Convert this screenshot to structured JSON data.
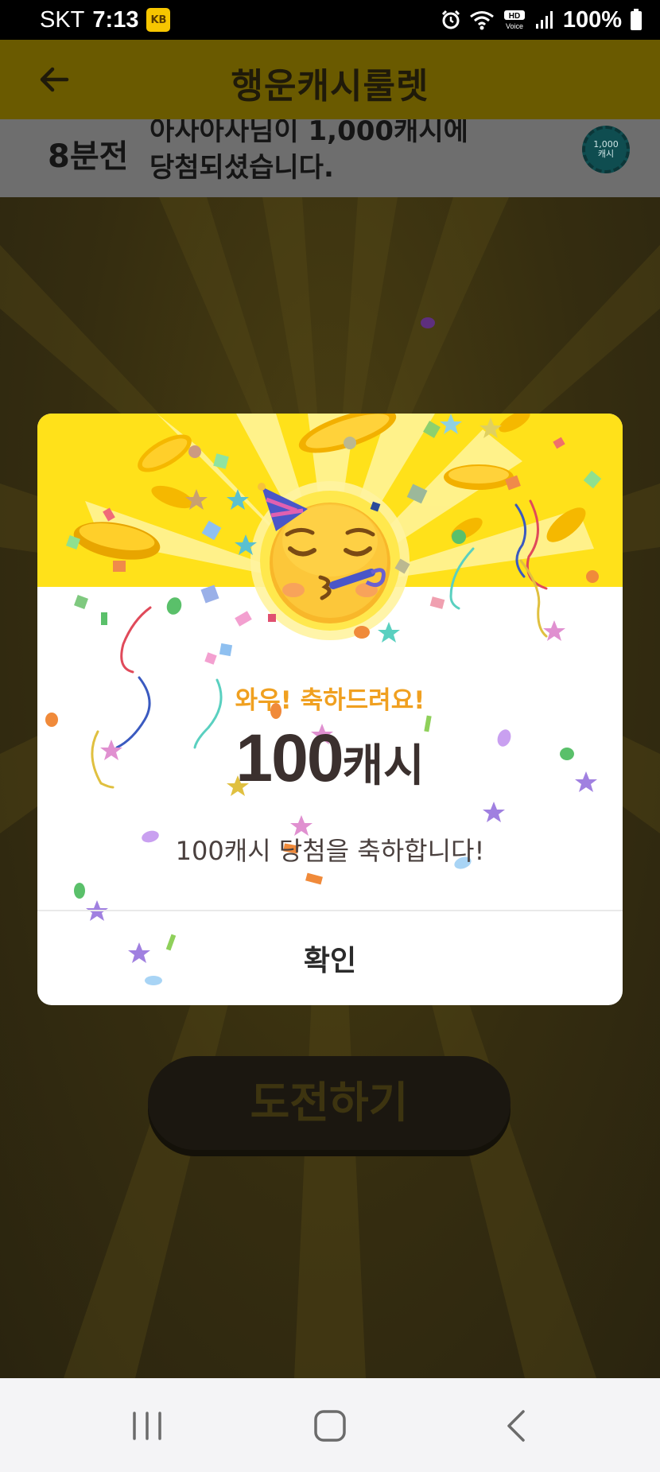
{
  "status_bar": {
    "carrier": "SKT",
    "time": "7:13",
    "kb_badge": "KB",
    "battery": "100%",
    "icons": [
      "kb-app-icon",
      "alarm-icon",
      "wifi-icon",
      "hd-voice-icon",
      "signal-icon",
      "battery-icon"
    ]
  },
  "header": {
    "title": "행운캐시룰렛",
    "back_icon": "arrow-left-icon"
  },
  "ticker": {
    "time_ago": "8분전",
    "line1": "아사아사님이 1,000캐시에",
    "line2": "당첨되셨습니다.",
    "coin_value": "1,000",
    "coin_unit": "캐시"
  },
  "main": {
    "challenge_button": "도전하기"
  },
  "dialog": {
    "subtitle": "와우! 축하드려요!",
    "amount_number": "100",
    "amount_unit": "캐시",
    "description": "100캐시 당첨을 축하합니다!",
    "confirm": "확인",
    "emoji": "partying-face-emoji"
  },
  "nav_bar": {
    "icons": [
      "recent-apps-icon",
      "home-icon",
      "back-icon"
    ]
  },
  "colors": {
    "header_bg": "#6a5a00",
    "dialog_top": "#ffe11a",
    "subtitle": "#f0a020",
    "amount": "#3b302e"
  }
}
